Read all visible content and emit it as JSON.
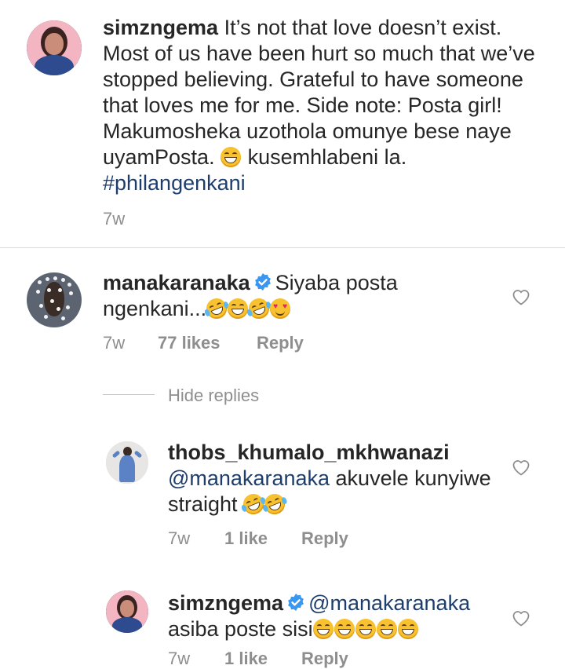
{
  "caption": {
    "username": "simzngema",
    "text": "It’s not that love doesn’t exist. Most of us have been hurt so much that we’ve stopped believing. Grateful to have someone that loves me for me.  Side note: Posta girl! Makumosheka uzothola omunye bese naye uyamPosta. ",
    "text_after_emoji": " kusemhlabeni la. ",
    "hashtag": "#philangenkani",
    "time": "7w"
  },
  "comments": [
    {
      "username": "manakaranaka",
      "verified": true,
      "text": "Siyaba posta ngenkani...",
      "time": "7w",
      "likes": "77 likes",
      "reply": "Reply"
    }
  ],
  "hide_replies_label": "Hide replies",
  "replies": [
    {
      "username": "thobs_khumalo_mkhwanazi",
      "mention": "@manakaranaka",
      "text": " akuvele kunyiwe straight",
      "time": "7w",
      "likes": "1 like",
      "reply": "Reply"
    },
    {
      "username": "simzngema",
      "verified": true,
      "mention": "@manakaranaka",
      "text": "asiba poste sisi",
      "time": "7w",
      "likes": "1 like",
      "reply": "Reply"
    }
  ],
  "colors": {
    "text": "#262626",
    "meta": "#8e8e8e",
    "link": "#1d3e6d",
    "verified": "#3897f0",
    "divider": "#dbdbdb"
  },
  "icons": {
    "like": "heart-outline-icon",
    "verified": "verified-badge-icon",
    "emoji_grin": "grinning-face-emoji",
    "emoji_rofl": "rolling-laughing-emoji",
    "emoji_hearts": "heart-eyes-emoji"
  }
}
